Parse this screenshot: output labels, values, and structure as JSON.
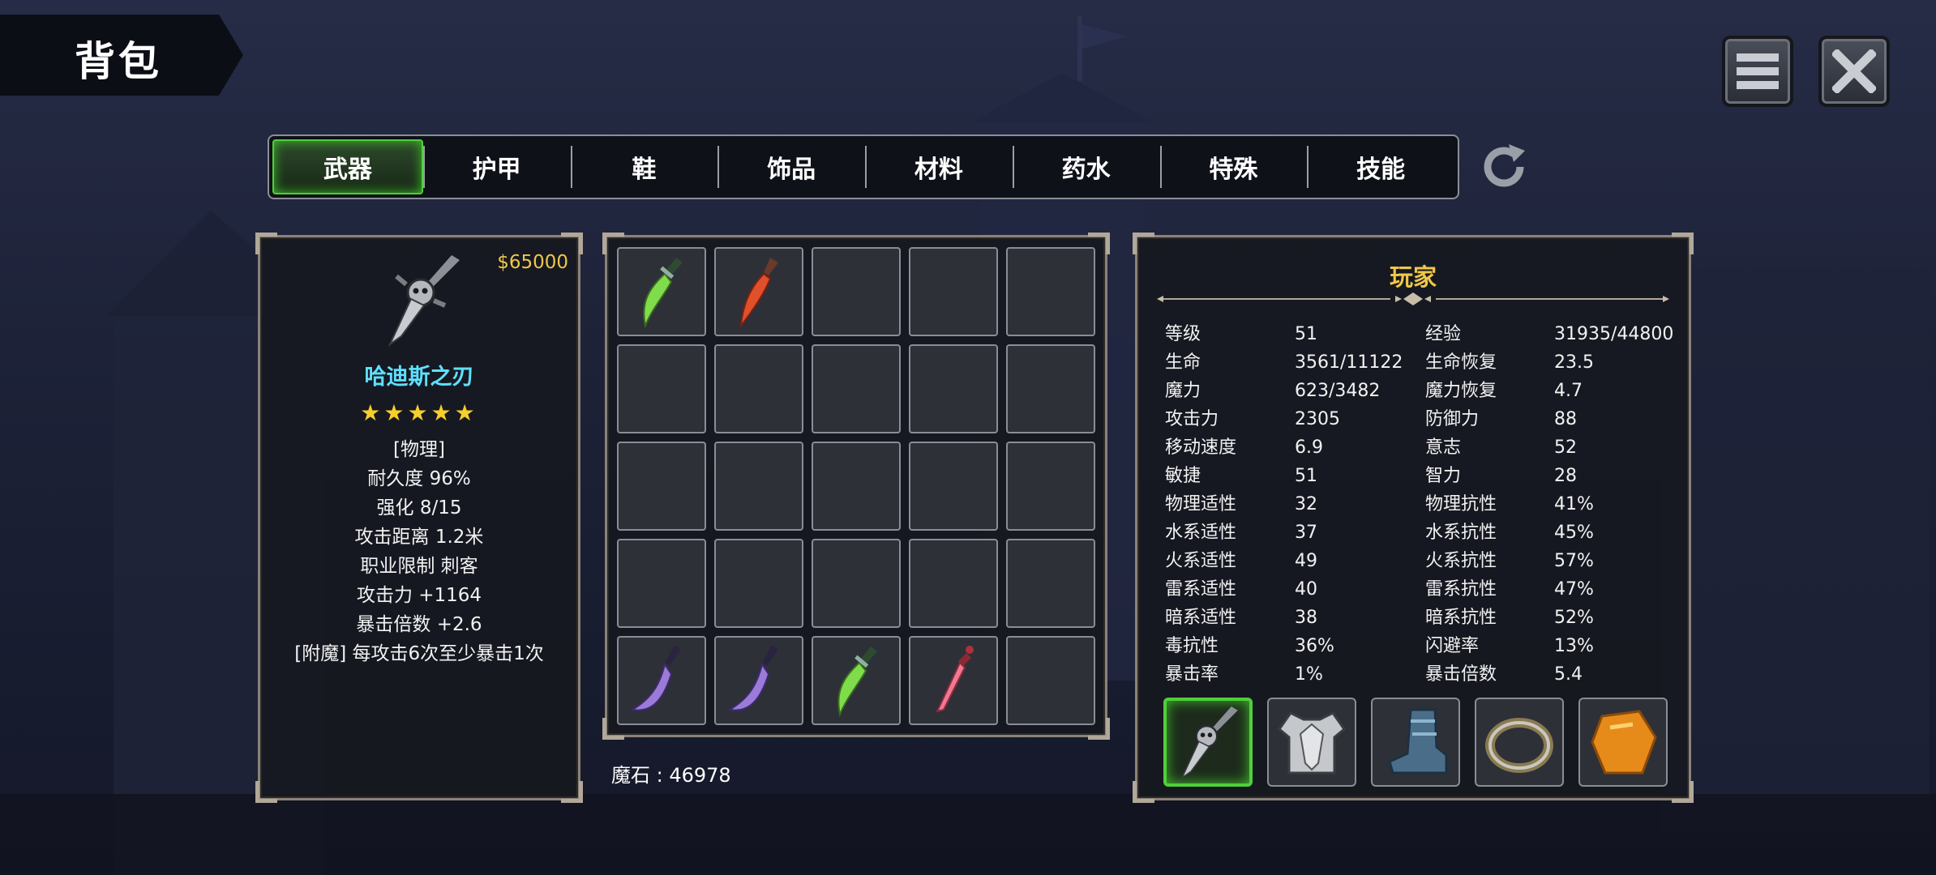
{
  "header": {
    "title": "背包"
  },
  "tabs": [
    {
      "label": "武器",
      "active": true
    },
    {
      "label": "护甲",
      "active": false
    },
    {
      "label": "鞋",
      "active": false
    },
    {
      "label": "饰品",
      "active": false
    },
    {
      "label": "材料",
      "active": false
    },
    {
      "label": "药水",
      "active": false
    },
    {
      "label": "特殊",
      "active": false
    },
    {
      "label": "技能",
      "active": false
    }
  ],
  "item": {
    "price": "$65000",
    "icon": "skull-dagger-icon",
    "name": "哈迪斯之刃",
    "stars": "★★★★★",
    "star_count": 5,
    "lines": [
      "[物理]",
      "耐久度 96%",
      "强化 8/15",
      "攻击距离  1.2米",
      "职业限制  刺客",
      "攻击力  +1164",
      "暴击倍数  +2.6",
      "[附魔] 每攻击6次至少暴击1次"
    ]
  },
  "inventory": {
    "slots": [
      "green-dagger-icon",
      "red-dagger-icon",
      "",
      "",
      "",
      "",
      "",
      "",
      "",
      "",
      "",
      "",
      "",
      "",
      "",
      "",
      "",
      "",
      "",
      "",
      "purple-scythe-dagger-icon",
      "purple-scythe-dagger-icon",
      "green-dagger-icon",
      "pink-dagger-icon",
      ""
    ]
  },
  "magic_stone": "魔石 : 46978",
  "player": {
    "title": "玩家",
    "stats": [
      [
        "等级",
        "51",
        "经验",
        "31935/44800"
      ],
      [
        "生命",
        "3561/11122",
        "生命恢复",
        "23.5"
      ],
      [
        "魔力",
        "623/3482",
        "魔力恢复",
        "4.7"
      ],
      [
        "攻击力",
        "2305",
        "防御力",
        "88"
      ],
      [
        "移动速度",
        "6.9",
        "意志",
        "52"
      ],
      [
        "敏捷",
        "51",
        "智力",
        "28"
      ],
      [
        "物理适性",
        "32",
        "物理抗性",
        "41%"
      ],
      [
        "水系适性",
        "37",
        "水系抗性",
        "45%"
      ],
      [
        "火系适性",
        "49",
        "火系抗性",
        "57%"
      ],
      [
        "雷系适性",
        "40",
        "雷系抗性",
        "47%"
      ],
      [
        "暗系适性",
        "38",
        "暗系抗性",
        "52%"
      ],
      [
        "毒抗性",
        "36%",
        "闪避率",
        "13%"
      ],
      [
        "暴击率",
        "1%",
        "暴击倍数",
        "5.4"
      ]
    ],
    "equipment": [
      "skull-dagger-icon",
      "chest-armor-icon",
      "boots-icon",
      "ring-icon",
      "amber-gem-icon"
    ]
  },
  "colors": {
    "accent_green": "#4fcf3a",
    "gold": "#f0c74a",
    "item_name": "#5ee0ff"
  }
}
